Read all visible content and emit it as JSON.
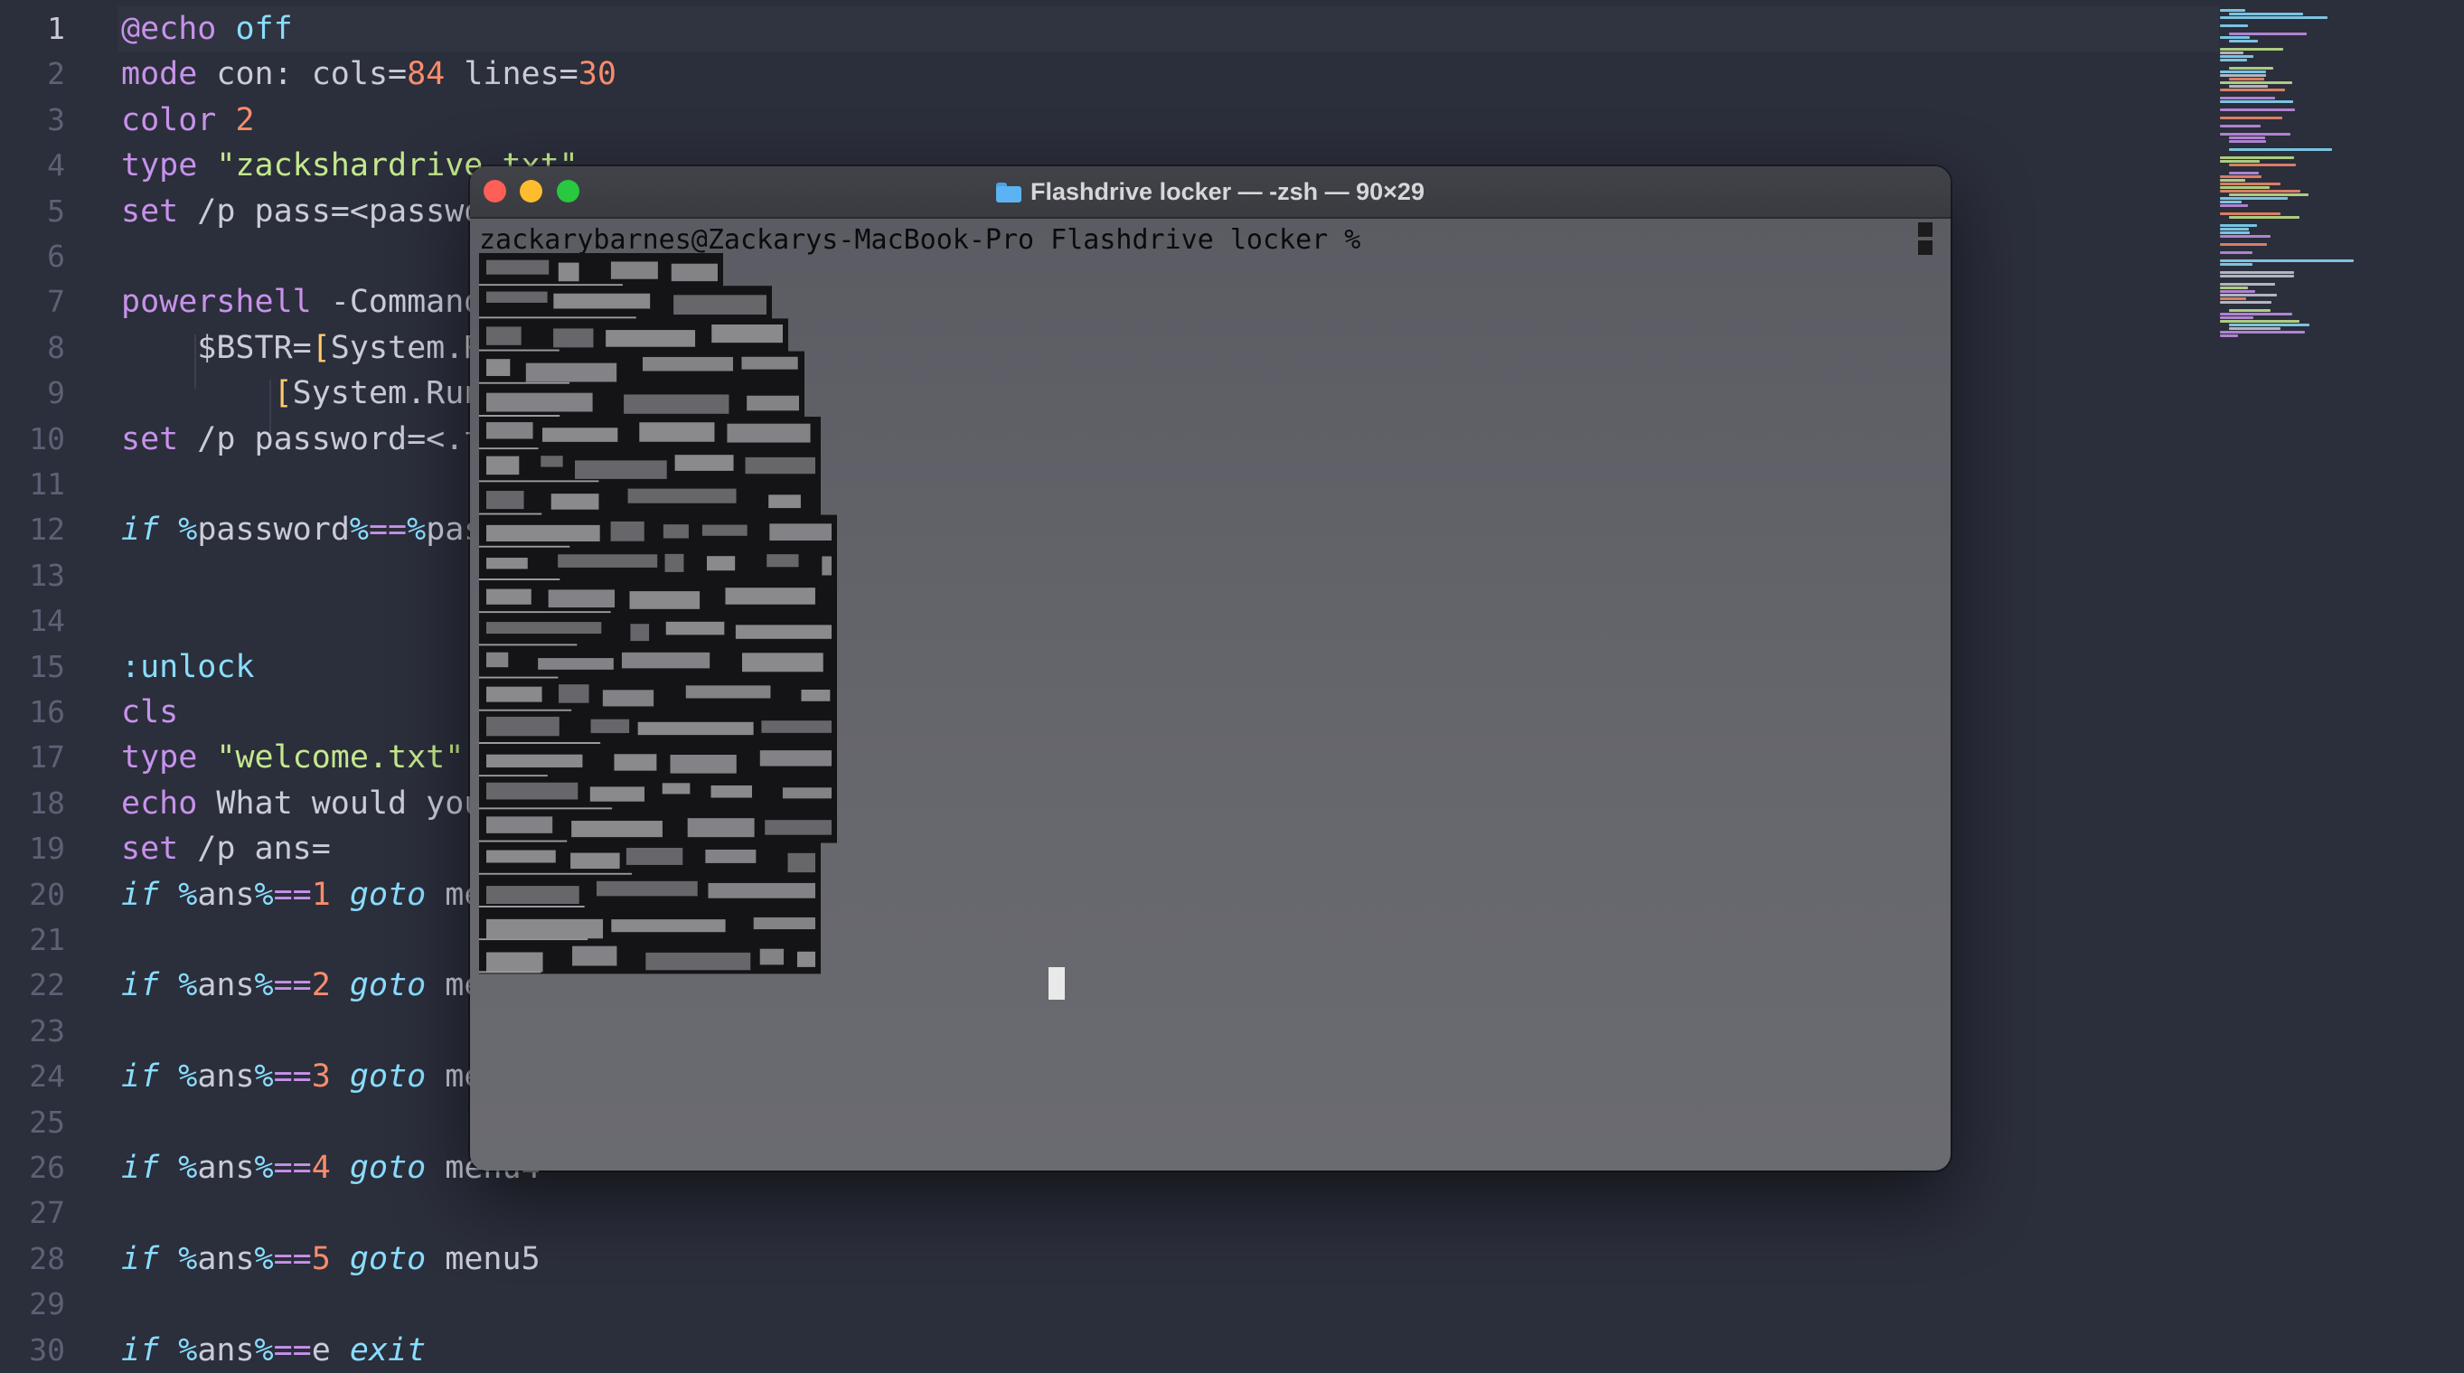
{
  "editor": {
    "lines": [
      {
        "n": "1",
        "tokens": [
          [
            "kw",
            "@echo"
          ],
          [
            "t",
            " "
          ],
          [
            "fn",
            "off"
          ]
        ]
      },
      {
        "n": "2",
        "tokens": [
          [
            "kw",
            "mode"
          ],
          [
            "t",
            " con: cols="
          ],
          [
            "num",
            "84"
          ],
          [
            "t",
            " lines="
          ],
          [
            "num",
            "30"
          ]
        ]
      },
      {
        "n": "3",
        "tokens": [
          [
            "kw",
            "color"
          ],
          [
            "t",
            " "
          ],
          [
            "num",
            "2"
          ]
        ]
      },
      {
        "n": "4",
        "tokens": [
          [
            "kw",
            "type"
          ],
          [
            "t",
            " "
          ],
          [
            "str",
            "\"zackshardrive.txt\""
          ]
        ]
      },
      {
        "n": "5",
        "tokens": [
          [
            "kw",
            "set"
          ],
          [
            "t",
            " /p pass=<passwo"
          ]
        ]
      },
      {
        "n": "6",
        "tokens": []
      },
      {
        "n": "7",
        "tokens": [
          [
            "kw",
            "powershell"
          ],
          [
            "t",
            " -Command"
          ]
        ]
      },
      {
        "n": "8",
        "tokens": [
          [
            "t",
            "    $BSTR="
          ],
          [
            "br",
            "["
          ],
          [
            "t",
            "System.R"
          ]
        ]
      },
      {
        "n": "9",
        "tokens": [
          [
            "t",
            "        "
          ],
          [
            "br",
            "["
          ],
          [
            "t",
            "System.Run"
          ]
        ]
      },
      {
        "n": "10",
        "tokens": [
          [
            "kw",
            "set"
          ],
          [
            "t",
            " /p password=<.t"
          ]
        ]
      },
      {
        "n": "11",
        "tokens": []
      },
      {
        "n": "12",
        "tokens": [
          [
            "it",
            "if"
          ],
          [
            "t",
            " "
          ],
          [
            "var",
            "%"
          ],
          [
            "t",
            "password"
          ],
          [
            "var",
            "%"
          ],
          [
            "kw",
            "=="
          ],
          [
            "var",
            "%"
          ],
          [
            "t",
            "pas"
          ]
        ]
      },
      {
        "n": "13",
        "tokens": []
      },
      {
        "n": "14",
        "tokens": []
      },
      {
        "n": "15",
        "tokens": [
          [
            "fn",
            ":unlock"
          ]
        ]
      },
      {
        "n": "16",
        "tokens": [
          [
            "kw",
            "cls"
          ]
        ]
      },
      {
        "n": "17",
        "tokens": [
          [
            "kw",
            "type"
          ],
          [
            "t",
            " "
          ],
          [
            "str",
            "\"welcome.txt\""
          ]
        ]
      },
      {
        "n": "18",
        "tokens": [
          [
            "kw",
            "echo"
          ],
          [
            "t",
            " What would you"
          ]
        ]
      },
      {
        "n": "19",
        "tokens": [
          [
            "kw",
            "set"
          ],
          [
            "t",
            " /p ans="
          ]
        ]
      },
      {
        "n": "20",
        "tokens": [
          [
            "it",
            "if"
          ],
          [
            "t",
            " "
          ],
          [
            "var",
            "%"
          ],
          [
            "t",
            "ans"
          ],
          [
            "var",
            "%"
          ],
          [
            "kw",
            "=="
          ],
          [
            "num",
            "1"
          ],
          [
            "t",
            " "
          ],
          [
            "it",
            "goto"
          ],
          [
            "t",
            " me"
          ]
        ]
      },
      {
        "n": "21",
        "tokens": []
      },
      {
        "n": "22",
        "tokens": [
          [
            "it",
            "if"
          ],
          [
            "t",
            " "
          ],
          [
            "var",
            "%"
          ],
          [
            "t",
            "ans"
          ],
          [
            "var",
            "%"
          ],
          [
            "kw",
            "=="
          ],
          [
            "num",
            "2"
          ],
          [
            "t",
            " "
          ],
          [
            "it",
            "goto"
          ],
          [
            "t",
            " me"
          ]
        ]
      },
      {
        "n": "23",
        "tokens": []
      },
      {
        "n": "24",
        "tokens": [
          [
            "it",
            "if"
          ],
          [
            "t",
            " "
          ],
          [
            "var",
            "%"
          ],
          [
            "t",
            "ans"
          ],
          [
            "var",
            "%"
          ],
          [
            "kw",
            "=="
          ],
          [
            "num",
            "3"
          ],
          [
            "t",
            " "
          ],
          [
            "it",
            "goto"
          ],
          [
            "t",
            " me"
          ]
        ]
      },
      {
        "n": "25",
        "tokens": []
      },
      {
        "n": "26",
        "tokens": [
          [
            "it",
            "if"
          ],
          [
            "t",
            " "
          ],
          [
            "var",
            "%"
          ],
          [
            "t",
            "ans"
          ],
          [
            "var",
            "%"
          ],
          [
            "kw",
            "=="
          ],
          [
            "num",
            "4"
          ],
          [
            "t",
            " "
          ],
          [
            "it",
            "goto"
          ],
          [
            "t",
            " menu4"
          ]
        ]
      },
      {
        "n": "27",
        "tokens": []
      },
      {
        "n": "28",
        "tokens": [
          [
            "it",
            "if"
          ],
          [
            "t",
            " "
          ],
          [
            "var",
            "%"
          ],
          [
            "t",
            "ans"
          ],
          [
            "var",
            "%"
          ],
          [
            "kw",
            "=="
          ],
          [
            "num",
            "5"
          ],
          [
            "t",
            " "
          ],
          [
            "it",
            "goto"
          ],
          [
            "t",
            " menu5"
          ]
        ]
      },
      {
        "n": "29",
        "tokens": []
      },
      {
        "n": "30",
        "tokens": [
          [
            "it",
            "if"
          ],
          [
            "t",
            " "
          ],
          [
            "var",
            "%"
          ],
          [
            "t",
            "ans"
          ],
          [
            "var",
            "%"
          ],
          [
            "kw",
            "=="
          ],
          [
            "t",
            "e "
          ],
          [
            "it",
            "exit"
          ]
        ]
      }
    ],
    "colors": {
      "background": "#2b2e3b",
      "keyword": "#c792ea",
      "function": "#89ddff",
      "number": "#f78c6c",
      "string": "#c3e88d",
      "bracket": "#ffcb6b",
      "line_number": "#5d6174"
    }
  },
  "terminal": {
    "title": "Flashdrive locker — -zsh — 90×29",
    "folder_icon": "folder-icon",
    "prompt": "zackarybarnes@Zackarys-MacBook-Pro Flashdrive locker %",
    "buttons": [
      "close",
      "minimize",
      "maximize"
    ]
  }
}
